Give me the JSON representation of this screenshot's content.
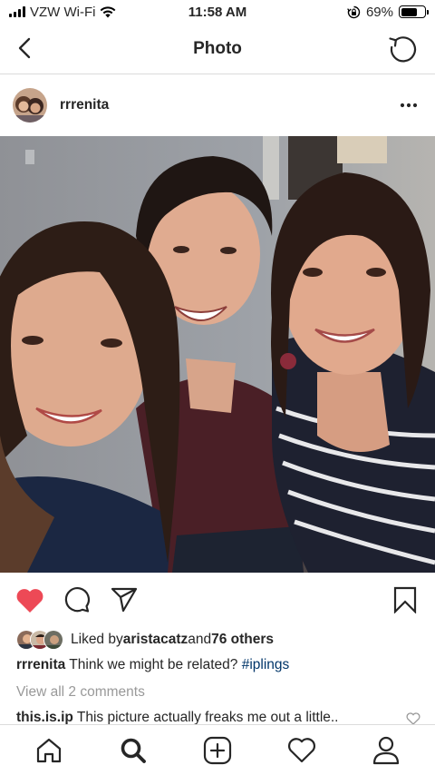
{
  "status_bar": {
    "carrier": "VZW Wi-Fi",
    "time": "11:58 AM",
    "battery_percent": "69%",
    "battery_level": 0.69,
    "icons": [
      "signal-icon",
      "wifi-icon",
      "orientation-lock-icon",
      "battery-icon"
    ]
  },
  "nav": {
    "title": "Photo",
    "back_icon": "chevron-left-icon",
    "refresh_icon": "refresh-icon"
  },
  "post": {
    "username": "rrrenita",
    "more_icon": "more-horizontal-icon",
    "liked": true,
    "like_color": "#ed4956"
  },
  "likes": {
    "prefix": "Liked by ",
    "user": "aristacatz",
    "middle": " and ",
    "others": "76 others"
  },
  "caption": {
    "username": "rrrenita",
    "text": " Think we might be related? ",
    "hashtag": "#iplings"
  },
  "comments": {
    "view_all": "View all 2 comments",
    "items": [
      {
        "username": "this.is.ip",
        "text": " This picture actually freaks me out a little.."
      }
    ]
  },
  "tab_bar": {
    "items": [
      "home-icon",
      "search-icon",
      "new-post-icon",
      "activity-icon",
      "profile-icon"
    ],
    "active": "search-icon"
  }
}
